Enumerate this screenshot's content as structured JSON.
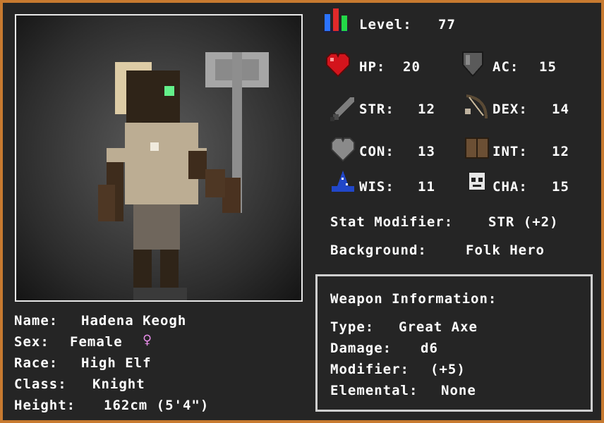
{
  "level": {
    "label": "Level:",
    "value": "77",
    "icon": "level-bars-icon"
  },
  "stats": {
    "hp": {
      "label": "HP:",
      "value": "20",
      "icon": "heart-icon"
    },
    "ac": {
      "label": "AC:",
      "value": "15",
      "icon": "shield-icon"
    },
    "str": {
      "label": "STR:",
      "value": "12",
      "icon": "sword-icon"
    },
    "dex": {
      "label": "DEX:",
      "value": "14",
      "icon": "bow-icon"
    },
    "con": {
      "label": "CON:",
      "value": "13",
      "icon": "grey-heart-icon"
    },
    "int": {
      "label": "INT:",
      "value": "12",
      "icon": "book-icon"
    },
    "wis": {
      "label": "WIS:",
      "value": "11",
      "icon": "wizard-hat-icon"
    },
    "cha": {
      "label": "CHA:",
      "value": "15",
      "icon": "mask-icon"
    }
  },
  "stat_modifier": {
    "label": "Stat Modifier:",
    "value": "STR (+2)"
  },
  "background": {
    "label": "Background:",
    "value": "Folk Hero"
  },
  "weapon": {
    "title": "Weapon Information:",
    "type": {
      "label": "Type:",
      "value": "Great Axe"
    },
    "damage": {
      "label": "Damage:",
      "value": "d6"
    },
    "modifier": {
      "label": "Modifier:",
      "value": "(+5)"
    },
    "elemental": {
      "label": "Elemental:",
      "value": "None"
    }
  },
  "character": {
    "name": {
      "label": "Name:",
      "value": "Hadena Keogh"
    },
    "sex": {
      "label": "Sex:",
      "value": "Female",
      "symbol": "♀"
    },
    "race": {
      "label": "Race:",
      "value": "High Elf"
    },
    "class": {
      "label": "Class:",
      "value": "Knight"
    },
    "height": {
      "label": "Height:",
      "value": "162cm (5'4\")"
    }
  },
  "colors": {
    "border": "#c77a30",
    "panel": "#252525",
    "text": "#ffffff",
    "female_symbol": "#e58be6",
    "eye": "#63f08a"
  }
}
